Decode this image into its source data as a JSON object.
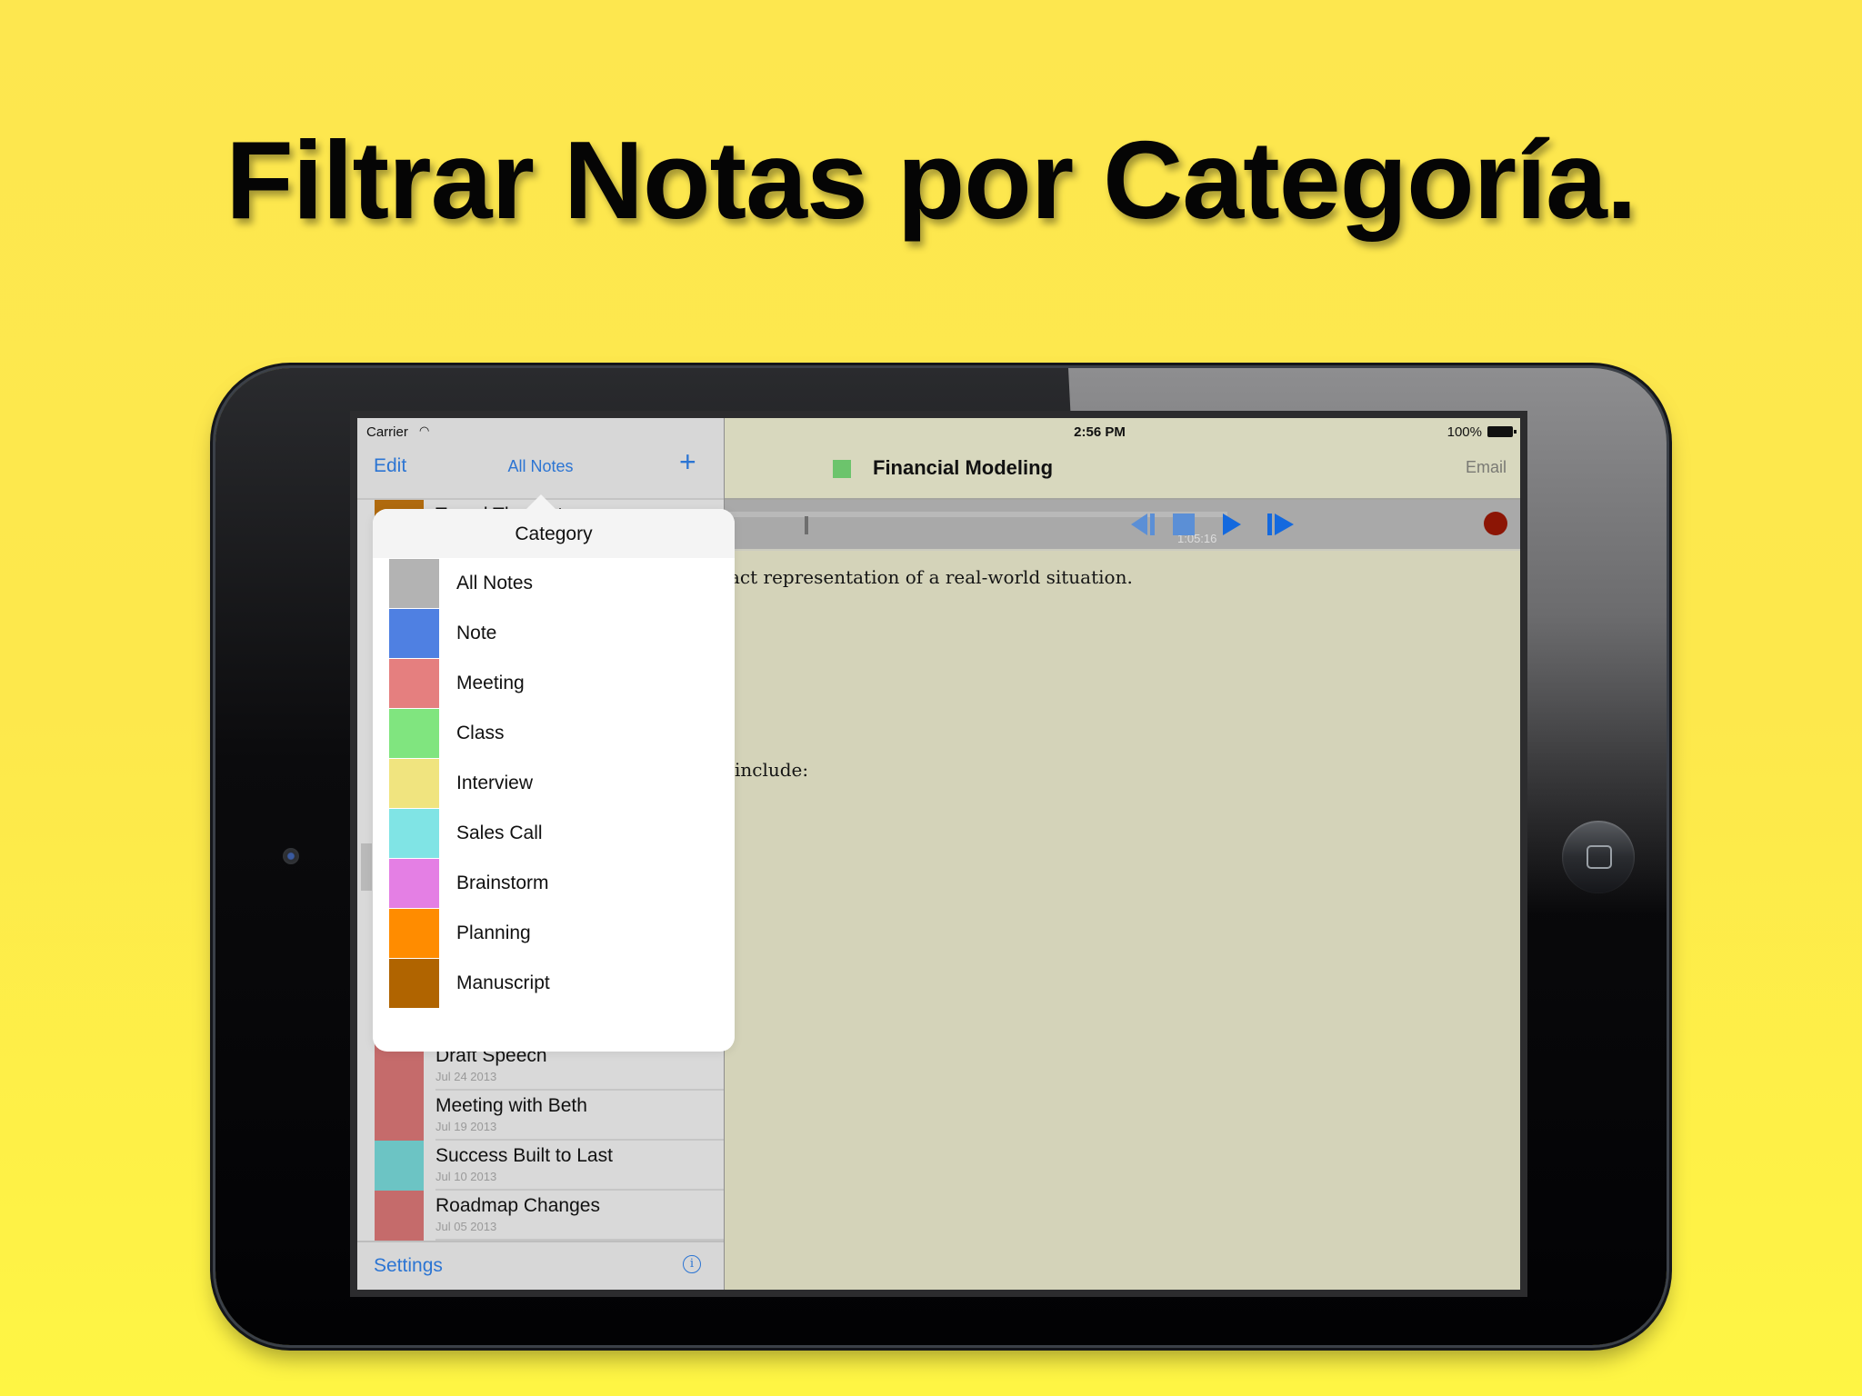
{
  "headline": "Filtrar Notas por Categoría.",
  "status_bar": {
    "carrier": "Carrier",
    "wifi_icon": "wifi-icon",
    "time": "2:56 PM",
    "battery": "100%"
  },
  "sidebar": {
    "edit_label": "Edit",
    "filter_label": "All Notes",
    "add_icon": "+",
    "partial_row": {
      "title": "Travel Thoughts",
      "color": "#b06a0e"
    },
    "notes": [
      {
        "title": "Draft Speech",
        "date": "Jul 24 2013",
        "color": "#c56b6b"
      },
      {
        "title": "Meeting with Beth",
        "date": "Jul 19 2013",
        "color": "#c56b6b"
      },
      {
        "title": "Success Built to Last",
        "date": "Jul 10 2013",
        "color": "#6cc4c4"
      },
      {
        "title": "Roadmap Changes",
        "date": "Jul 05 2013",
        "color": "#c56b6b"
      }
    ],
    "settings_label": "Settings",
    "info_icon": "i"
  },
  "detail": {
    "note_title": "Financial Modeling",
    "category_color": "#6cc46c",
    "email_label": "Email",
    "player": {
      "elapsed": "1:05:16",
      "progress": 0.16
    },
    "body_lines": [
      "act representation of a real-world situation.",
      "include:"
    ]
  },
  "popover": {
    "title": "Category",
    "items": [
      {
        "label": "All Notes",
        "color": "#b3b3b3"
      },
      {
        "label": "Note",
        "color": "#4f80e2"
      },
      {
        "label": "Meeting",
        "color": "#e57f7f"
      },
      {
        "label": "Class",
        "color": "#80e57f"
      },
      {
        "label": "Interview",
        "color": "#f0e47f"
      },
      {
        "label": "Sales Call",
        "color": "#80e4e5"
      },
      {
        "label": "Brainstorm",
        "color": "#e47fe4"
      },
      {
        "label": "Planning",
        "color": "#ff8c00"
      },
      {
        "label": "Manuscript",
        "color": "#b06400"
      }
    ]
  }
}
